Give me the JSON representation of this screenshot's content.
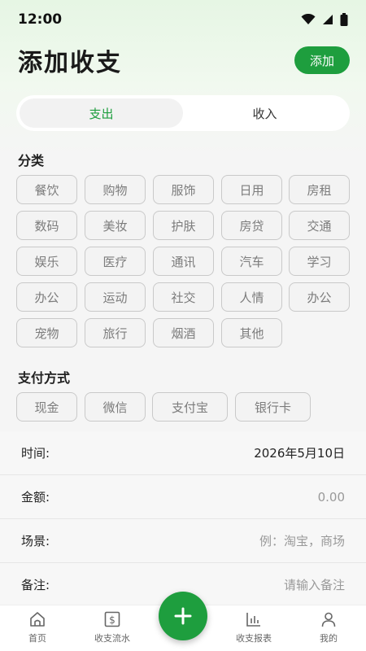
{
  "status_bar": {
    "time": "12:00"
  },
  "header": {
    "title": "添加收支",
    "add_label": "添加"
  },
  "tabs": [
    {
      "label": "支出",
      "active": true
    },
    {
      "label": "收入",
      "active": false
    }
  ],
  "category_section": {
    "title": "分类",
    "items": [
      "餐饮",
      "购物",
      "服饰",
      "日用",
      "房租",
      "数码",
      "美妆",
      "护肤",
      "房贷",
      "交通",
      "娱乐",
      "医疗",
      "通讯",
      "汽车",
      "学习",
      "办公",
      "运动",
      "社交",
      "人情",
      "办公",
      "宠物",
      "旅行",
      "烟酒",
      "其他"
    ]
  },
  "payment_section": {
    "title": "支付方式",
    "items": [
      "现金",
      "微信",
      "支付宝",
      "银行卡"
    ]
  },
  "form": {
    "time_label": "时间:",
    "time_value": "2026年5月10日",
    "amount_label": "金额:",
    "amount_placeholder": "0.00",
    "scene_label": "场景:",
    "scene_placeholder": "例：淘宝，商场",
    "note_label": "备注:",
    "note_placeholder": "请输入备注"
  },
  "bottom_nav": {
    "home": "首页",
    "flow": "收支流水",
    "report": "收支报表",
    "mine": "我的"
  },
  "colors": {
    "accent": "#1e9e3e",
    "chip_border": "#c9c9c9",
    "chip_text": "#7c7c7c"
  }
}
